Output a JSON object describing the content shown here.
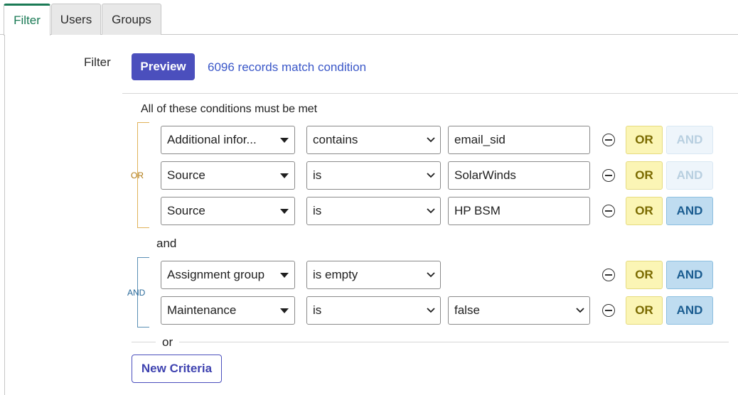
{
  "tabs": [
    {
      "label": "Filter",
      "active": true
    },
    {
      "label": "Users",
      "active": false
    },
    {
      "label": "Groups",
      "active": false
    }
  ],
  "filter": {
    "label": "Filter",
    "preview_label": "Preview",
    "match_text": "6096 records match condition",
    "conditions_title": "All of these conditions must be met"
  },
  "groups": [
    {
      "join_label": "OR",
      "rows": [
        {
          "field": "Additional infor...",
          "operator": "contains",
          "value": "email_sid",
          "value_type": "text",
          "or_label": "OR",
          "and_label": "AND",
          "and_enabled": false
        },
        {
          "field": "Source",
          "operator": "is",
          "value": "SolarWinds",
          "value_type": "text",
          "or_label": "OR",
          "and_label": "AND",
          "and_enabled": false
        },
        {
          "field": "Source",
          "operator": "is",
          "value": "HP BSM",
          "value_type": "text",
          "or_label": "OR",
          "and_label": "AND",
          "and_enabled": true
        }
      ]
    },
    {
      "join_label": "AND",
      "rows": [
        {
          "field": "Assignment group",
          "operator": "is empty",
          "value": "",
          "value_type": "none",
          "or_label": "OR",
          "and_label": "AND",
          "and_enabled": true
        },
        {
          "field": "Maintenance",
          "operator": "is",
          "value": "false",
          "value_type": "select",
          "or_label": "OR",
          "and_label": "AND",
          "and_enabled": true
        }
      ]
    }
  ],
  "between_groups_label": "and",
  "or_separator_label": "or",
  "new_criteria_label": "New Criteria",
  "colors": {
    "accent_green": "#1a7a55",
    "primary_button": "#4b4fbd",
    "link": "#3a57c8",
    "or_button": "#fbf5b5",
    "and_button": "#bfdcf0"
  }
}
